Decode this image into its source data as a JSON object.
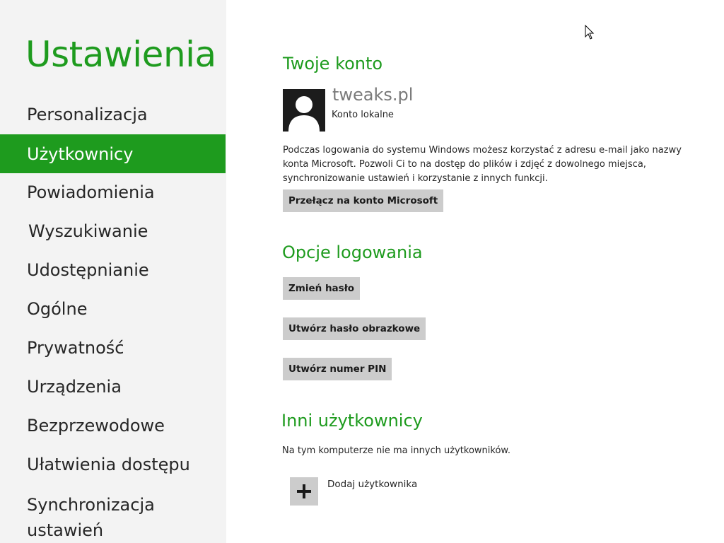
{
  "sidebar": {
    "title": "Ustawienia",
    "items": [
      {
        "label": "Personalizacja"
      },
      {
        "label": "Użytkownicy",
        "active": true
      },
      {
        "label": "Powiadomienia"
      },
      {
        "label": "Wyszukiwanie"
      },
      {
        "label": "Udostępnianie"
      },
      {
        "label": "Ogólne"
      },
      {
        "label": "Prywatność"
      },
      {
        "label": "Urządzenia"
      },
      {
        "label": "Bezprzewodowe"
      },
      {
        "label": "Ułatwienia dostępu"
      },
      {
        "label": "Synchronizacja ustawień"
      }
    ]
  },
  "account": {
    "section_title": "Twoje konto",
    "name": "tweaks.pl",
    "type": "Konto lokalne",
    "description": "Podczas logowania do systemu Windows możesz korzystać z adresu e-mail jako nazwy konta Microsoft. Pozwoli Ci to na dostęp do plików i zdjęć z dowolnego miejsca, synchronizowanie ustawień i korzystanie z innych funkcji.",
    "switch_button": "Przełącz na konto Microsoft"
  },
  "sign_in_options": {
    "section_title": "Opcje logowania",
    "change_password": "Zmień hasło",
    "create_picture_password": "Utwórz hasło obrazkowe",
    "create_pin": "Utwórz numer PIN"
  },
  "other_users": {
    "section_title": "Inni użytkownicy",
    "info": "Na tym komputerze nie ma innych użytkowników.",
    "add_user": "Dodaj użytkownika"
  },
  "colors": {
    "accent": "#1e9b1e",
    "sidebar_bg": "#f3f3f3",
    "button_bg": "#cccccc"
  },
  "icons": {
    "avatar": "user-silhouette-icon",
    "add": "plus-icon",
    "pointer": "mouse-cursor-icon"
  }
}
